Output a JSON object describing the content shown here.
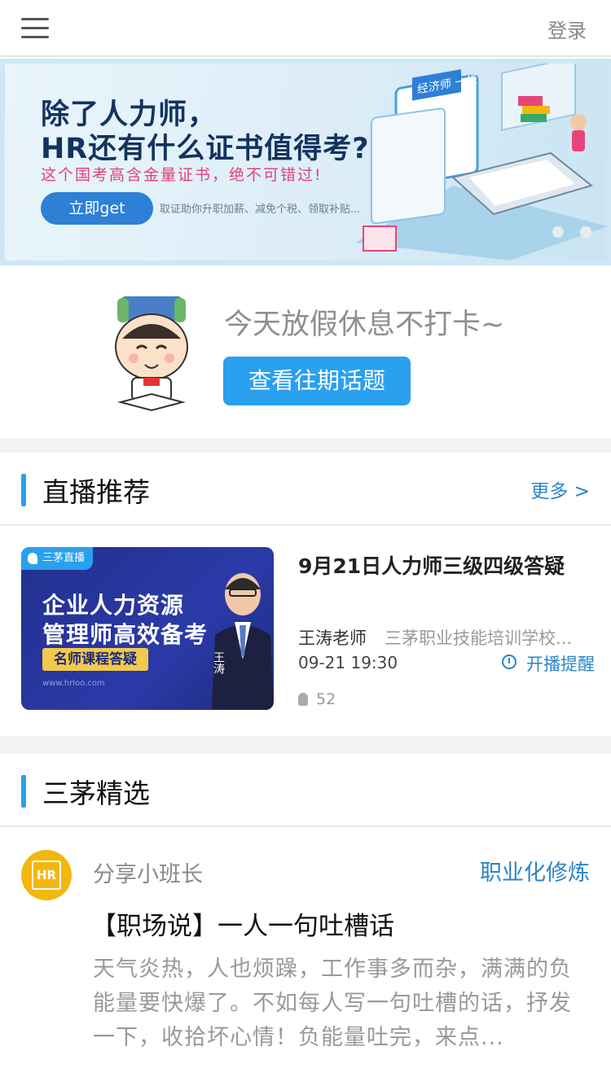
{
  "header": {
    "menu_icon": "hamburger-menu-icon",
    "login_label": "登录"
  },
  "banner": {
    "title_line1": "除了人力师，",
    "title_line2": "HR还有什么证书值得考?",
    "subtitle": "这个国考高含金量证书，绝不可错过!",
    "button_label": "立即get",
    "small_text": "取证助你升职加薪、减免个税、领取补贴...",
    "card_label": "经济师 一级",
    "slide_count": 2,
    "active_slide": 1
  },
  "checkin": {
    "message": "今天放假休息不打卡~",
    "button_label": "查看往期话题"
  },
  "live_section": {
    "title": "直播推荐",
    "more_label": "更多 >",
    "item": {
      "tag": "三茅直播",
      "thumb_line1": "企业人力资源",
      "thumb_line2": "管理师高效备考",
      "thumb_line3": "名师课程答疑",
      "thumb_url": "www.hrloo.com",
      "thumb_person": "王涛",
      "title": "9月21日人力师三级四级答疑",
      "teacher": "王涛老师",
      "school": "三茅职业技能培训学校...",
      "time": "09-21 19:30",
      "remind_label": "开播提醒",
      "hot_count": "52"
    }
  },
  "featured_section": {
    "title": "三茅精选",
    "post": {
      "avatar_text": "HR",
      "author": "分享小班长",
      "category": "职业化修炼",
      "title": "【职场说】一人一句吐槽话",
      "excerpt": "天气炎热，人也烦躁，工作事多而杂，满满的负能量要快爆了。不如每人写一句吐槽的话，抒发一下，收拾坏心情！负能量吐完，来点..."
    }
  },
  "colors": {
    "accent": "#2aa0ee",
    "link": "#2b86c8",
    "banner_title": "#13335f",
    "banner_sub": "#e2407a",
    "avatar": "#f2b80f"
  }
}
